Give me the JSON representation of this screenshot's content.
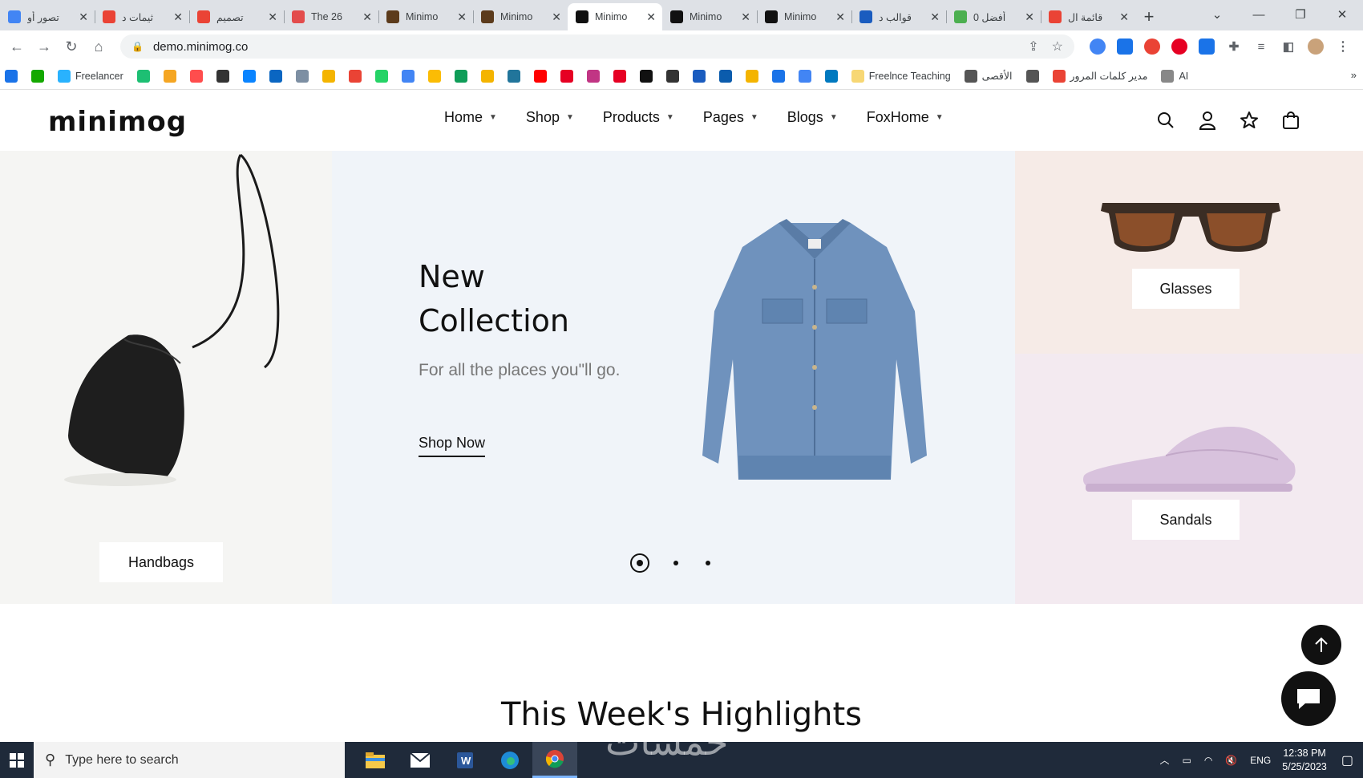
{
  "browser": {
    "tabs": [
      {
        "title": "تصور أو",
        "favicon_color": "#4285f4",
        "active": false
      },
      {
        "title": "ثيمات د",
        "favicon_color": "#ea4335",
        "active": false
      },
      {
        "title": "تصميم",
        "favicon_color": "#ea4335",
        "active": false
      },
      {
        "title": "The 26",
        "favicon_color": "#e34c4c",
        "active": false
      },
      {
        "title": "Minimo",
        "favicon_color": "#5c3b1c",
        "active": false
      },
      {
        "title": "Minimo",
        "favicon_color": "#5c3b1c",
        "active": false
      },
      {
        "title": "Minimo",
        "favicon_color": "#111111",
        "active": true
      },
      {
        "title": "Minimo",
        "favicon_color": "#111111",
        "active": false
      },
      {
        "title": "Minimo",
        "favicon_color": "#111111",
        "active": false
      },
      {
        "title": "قوالب د",
        "favicon_color": "#1a5cbf",
        "active": false
      },
      {
        "title": "أفضل 0",
        "favicon_color": "#4caf50",
        "active": false
      },
      {
        "title": "قائمة ال",
        "favicon_color": "#ea4335",
        "active": false
      }
    ],
    "close_glyph": "✕",
    "newtab_glyph": "+",
    "window_controls": [
      "⌄",
      "—",
      "❐",
      "✕"
    ],
    "url": "demo.minimog.co",
    "bookmarks": [
      {
        "label": "",
        "color": "#1a73e8"
      },
      {
        "label": "",
        "color": "#14a800"
      },
      {
        "label": "Freelancer",
        "color": "#29b2fe"
      },
      {
        "label": "",
        "color": "#1dbf73"
      },
      {
        "label": "",
        "color": "#f5a623"
      },
      {
        "label": "",
        "color": "#ff4d4d"
      },
      {
        "label": "",
        "color": "#333333"
      },
      {
        "label": "",
        "color": "#0a84ff"
      },
      {
        "label": "",
        "color": "#0a66c2"
      },
      {
        "label": "",
        "color": "#7d8fa3"
      },
      {
        "label": "",
        "color": "#f4b400"
      },
      {
        "label": "",
        "color": "#ea4335"
      },
      {
        "label": "",
        "color": "#25d366"
      },
      {
        "label": "",
        "color": "#4285f4"
      },
      {
        "label": "",
        "color": "#fbbc04"
      },
      {
        "label": "",
        "color": "#0f9d58"
      },
      {
        "label": "",
        "color": "#f4b400"
      },
      {
        "label": "",
        "color": "#21759b"
      },
      {
        "label": "",
        "color": "#ff0000"
      },
      {
        "label": "",
        "color": "#e60023"
      },
      {
        "label": "",
        "color": "#c13584"
      },
      {
        "label": "",
        "color": "#e60023"
      },
      {
        "label": "",
        "color": "#111111"
      },
      {
        "label": "",
        "color": "#333333"
      },
      {
        "label": "",
        "color": "#1a5cbf"
      },
      {
        "label": "",
        "color": "#0b5cad"
      },
      {
        "label": "",
        "color": "#f4b400"
      },
      {
        "label": "",
        "color": "#1a73e8"
      },
      {
        "label": "",
        "color": "#4285f4"
      },
      {
        "label": "",
        "color": "#0079bf"
      },
      {
        "label": "Freelnce Teaching",
        "color": "#f7d774"
      },
      {
        "label": "الأقصى",
        "color": "#555555"
      },
      {
        "label": "",
        "color": "#555555"
      },
      {
        "label": "مدير كلمات المرور",
        "color": "#ea4335"
      },
      {
        "label": "AI",
        "color": "#888888"
      }
    ],
    "bookmarks_more": "»"
  },
  "site": {
    "logo": "minimog",
    "nav": [
      {
        "label": "Home"
      },
      {
        "label": "Shop"
      },
      {
        "label": "Products"
      },
      {
        "label": "Pages"
      },
      {
        "label": "Blogs"
      },
      {
        "label": "FoxHome"
      }
    ],
    "hero": {
      "title_line1": "New",
      "title_line2": "Collection",
      "subtitle": "For all the places you\"ll go.",
      "cta": "Shop Now",
      "slides": 3,
      "active_slide": 0
    },
    "categories": {
      "left": "Handbags",
      "top_right": "Glasses",
      "bottom_right": "Sandals"
    },
    "section_heading": "This Week's Highlights"
  },
  "taskbar": {
    "search_placeholder": "Type here to search",
    "language": "ENG",
    "time": "12:38 PM",
    "date": "5/25/2023",
    "watermark": "خمسات"
  }
}
